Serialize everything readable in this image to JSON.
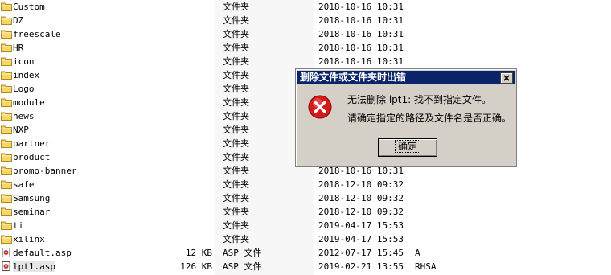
{
  "files": [
    {
      "name": "Custom",
      "kind": "folder",
      "size": "",
      "type": "文件夹",
      "date": "2018-10-16 10:31",
      "attr": ""
    },
    {
      "name": "DZ",
      "kind": "folder",
      "size": "",
      "type": "文件夹",
      "date": "2018-10-16 10:31",
      "attr": ""
    },
    {
      "name": "freescale",
      "kind": "folder",
      "size": "",
      "type": "文件夹",
      "date": "2018-10-16 10:31",
      "attr": ""
    },
    {
      "name": "HR",
      "kind": "folder",
      "size": "",
      "type": "文件夹",
      "date": "2018-10-16 10:31",
      "attr": ""
    },
    {
      "name": "icon",
      "kind": "folder",
      "size": "",
      "type": "文件夹",
      "date": "2018-10-16 10:31",
      "attr": ""
    },
    {
      "name": "index",
      "kind": "folder",
      "size": "",
      "type": "文件夹",
      "date": "",
      "attr": ""
    },
    {
      "name": "Logo",
      "kind": "folder",
      "size": "",
      "type": "文件夹",
      "date": "",
      "attr": ""
    },
    {
      "name": "module",
      "kind": "folder",
      "size": "",
      "type": "文件夹",
      "date": "",
      "attr": ""
    },
    {
      "name": "news",
      "kind": "folder",
      "size": "",
      "type": "文件夹",
      "date": "",
      "attr": ""
    },
    {
      "name": "NXP",
      "kind": "folder",
      "size": "",
      "type": "文件夹",
      "date": "",
      "attr": ""
    },
    {
      "name": "partner",
      "kind": "folder",
      "size": "",
      "type": "文件夹",
      "date": "",
      "attr": ""
    },
    {
      "name": "product",
      "kind": "folder",
      "size": "",
      "type": "文件夹",
      "date": "",
      "attr": ""
    },
    {
      "name": "promo-banner",
      "kind": "folder",
      "size": "",
      "type": "文件夹",
      "date": "2018-10-16 10:31",
      "attr": ""
    },
    {
      "name": "safe",
      "kind": "folder",
      "size": "",
      "type": "文件夹",
      "date": "2018-12-10 09:32",
      "attr": ""
    },
    {
      "name": "Samsung",
      "kind": "folder",
      "size": "",
      "type": "文件夹",
      "date": "2018-12-10 09:32",
      "attr": ""
    },
    {
      "name": "seminar",
      "kind": "folder",
      "size": "",
      "type": "文件夹",
      "date": "2018-12-10 09:32",
      "attr": ""
    },
    {
      "name": "ti",
      "kind": "folder",
      "size": "",
      "type": "文件夹",
      "date": "2019-04-17 15:53",
      "attr": ""
    },
    {
      "name": "xilinx",
      "kind": "folder",
      "size": "",
      "type": "文件夹",
      "date": "2019-04-17 15:53",
      "attr": ""
    },
    {
      "name": "default.asp",
      "kind": "asp",
      "size": "12 KB",
      "type": "ASP 文件",
      "date": "2012-07-17 15:45",
      "attr": "A"
    },
    {
      "name": "lpt1.asp",
      "kind": "asp",
      "size": "126 KB",
      "type": "ASP 文件",
      "date": "2019-02-21 13:55",
      "attr": "RHSA"
    }
  ],
  "selected_index": 19,
  "dialog": {
    "title": "删除文件或文件夹时出错",
    "message_line1": "无法删除 lpt1: 找不到指定文件。",
    "message_line2": "请确定指定的路径及文件名是否正确。",
    "ok_label": "确定",
    "icon": "error-icon",
    "close_icon": "close-icon"
  },
  "colors": {
    "titlebar": "#0a246a",
    "dialog_bg": "#d4d0c8",
    "folder": "#f5d66a",
    "error_red": "#d41a1a"
  }
}
